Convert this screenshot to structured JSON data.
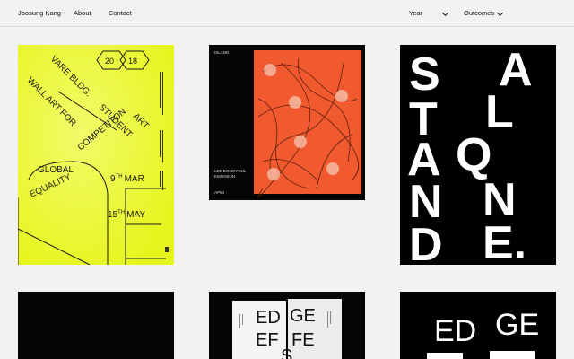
{
  "header": {
    "brand": "Joosung Kang",
    "nav": [
      "About",
      "Contact"
    ],
    "filters": [
      "Year",
      "Outcomes"
    ]
  },
  "colors": {
    "background": "#f2f2f2",
    "neon": "#e8f71f",
    "orange": "#f05a2e",
    "black": "#050505"
  },
  "works": {
    "poster1": {
      "lines": [
        "WALL ART FOR",
        "VARE BLDG.",
        "STUDENT",
        "ART",
        "COMPETITON",
        "GLOBAL",
        "EQUALITY"
      ],
      "year_left": "20",
      "year_right": "18",
      "date1_num": "9",
      "date1_sup": "TH",
      "date1_month": "MAR",
      "date2_num": "15",
      "date2_sup": "TH",
      "date2_month": "MAY"
    },
    "poster2": {
      "title": "ISLAND",
      "names": [
        "LEE DONGYOUL",
        "KIM KIEUN"
      ],
      "code": "AP64"
    },
    "poster3": {
      "letters": [
        "S",
        "A",
        "T",
        "L",
        "A",
        "Q",
        "N",
        "N",
        "D",
        "E."
      ]
    },
    "poster5": {
      "letters": [
        "ED",
        "GE",
        "EF",
        "FE",
        "S"
      ]
    },
    "poster6": {
      "letters": [
        "ED",
        "GE"
      ]
    }
  }
}
